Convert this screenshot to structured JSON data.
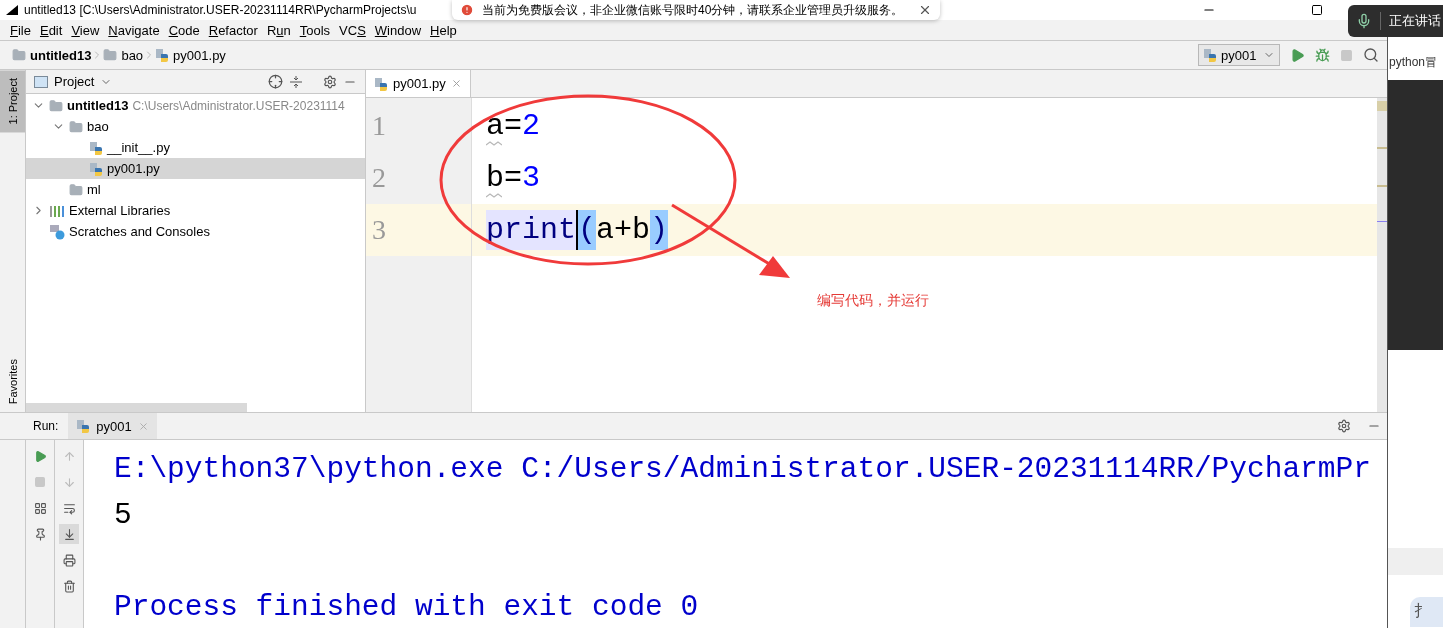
{
  "window": {
    "title": "untitled13 [C:\\Users\\Administrator.USER-20231114RR\\PycharmProjects\\u"
  },
  "notification": {
    "message": "当前为免费版会议，非企业微信账号限时40分钟，请联系企业管理员升级服务。"
  },
  "voice_indicator": {
    "label": "正在讲话"
  },
  "menu": [
    {
      "key": "F",
      "post": "ile"
    },
    {
      "key": "E",
      "post": "dit"
    },
    {
      "key": "V",
      "post": "iew"
    },
    {
      "key": "N",
      "post": "avigate"
    },
    {
      "key": "C",
      "post": "ode"
    },
    {
      "key": "R",
      "post": "efactor"
    },
    {
      "pre": "R",
      "key": "u",
      "post": "n"
    },
    {
      "key": "T",
      "post": "ools"
    },
    {
      "pre": "VC",
      "key": "S"
    },
    {
      "key": "W",
      "post": "indow"
    },
    {
      "key": "H",
      "post": "elp"
    }
  ],
  "breadcrumbs": [
    {
      "label": "untitled13",
      "kind": "project"
    },
    {
      "label": "bao",
      "kind": "folder"
    },
    {
      "label": "py001.py",
      "kind": "python"
    }
  ],
  "run_config": {
    "label": "py001"
  },
  "tool_strip": {
    "top": {
      "label": "1: Project",
      "selected": true
    },
    "bottom": {
      "label": "Favorites",
      "selected": false
    }
  },
  "project_panel": {
    "title": "Project",
    "tree": [
      {
        "label": "untitled13",
        "path": "C:\\Users\\Administrator.USER-20231114",
        "kind": "project",
        "expanded": true,
        "selected": false,
        "children": [
          {
            "label": "bao",
            "kind": "folder",
            "expanded": true,
            "selected": false,
            "children": [
              {
                "label": "__init__.py",
                "kind": "python",
                "selected": false
              },
              {
                "label": "py001.py",
                "kind": "python",
                "selected": true
              }
            ]
          },
          {
            "label": "ml",
            "kind": "folder",
            "selected": false
          }
        ]
      },
      {
        "label": "External Libraries",
        "kind": "libraries",
        "expanded": false,
        "selected": false
      },
      {
        "label": "Scratches and Consoles",
        "kind": "scratches",
        "selected": false
      }
    ]
  },
  "editor": {
    "tab": {
      "label": "py001.py",
      "selected": true
    },
    "lines": [
      {
        "number": "1",
        "current": false,
        "tokens": [
          {
            "text": "a",
            "kind": "plain",
            "warning": true
          },
          {
            "text": "=",
            "kind": "plain",
            "warning": false
          },
          {
            "text": "2",
            "kind": "number",
            "warning": false
          }
        ]
      },
      {
        "number": "2",
        "current": false,
        "tokens": [
          {
            "text": "b",
            "kind": "plain",
            "warning": true
          },
          {
            "text": "=",
            "kind": "plain",
            "warning": false
          },
          {
            "text": "3",
            "kind": "number",
            "warning": false
          }
        ]
      },
      {
        "number": "3",
        "current": true,
        "tokens": [
          {
            "text": "print",
            "kind": "highlighted",
            "warning": false
          },
          {
            "kind": "caret",
            "warning": false
          },
          {
            "text": "(",
            "kind": "brace-match",
            "warning": false
          },
          {
            "text": "a+b",
            "kind": "plain",
            "warning": false
          },
          {
            "text": ")",
            "kind": "brace-match",
            "warning": false
          }
        ]
      }
    ]
  },
  "annotation": {
    "text": "编写代码，并运行"
  },
  "run_panel": {
    "label": "Run:",
    "tab": {
      "label": "py001",
      "selected": true
    },
    "console": [
      {
        "text": "E:\\python37\\python.exe C:/Users/Administrator.USER-20231114RR/PycharmPr",
        "kind": "system"
      },
      {
        "text": "5",
        "kind": "output"
      },
      {
        "kind": "blank"
      },
      {
        "text": "Process finished with exit code 0",
        "kind": "system"
      }
    ]
  },
  "side_window": {
    "title": "python冒",
    "button": "扌"
  }
}
